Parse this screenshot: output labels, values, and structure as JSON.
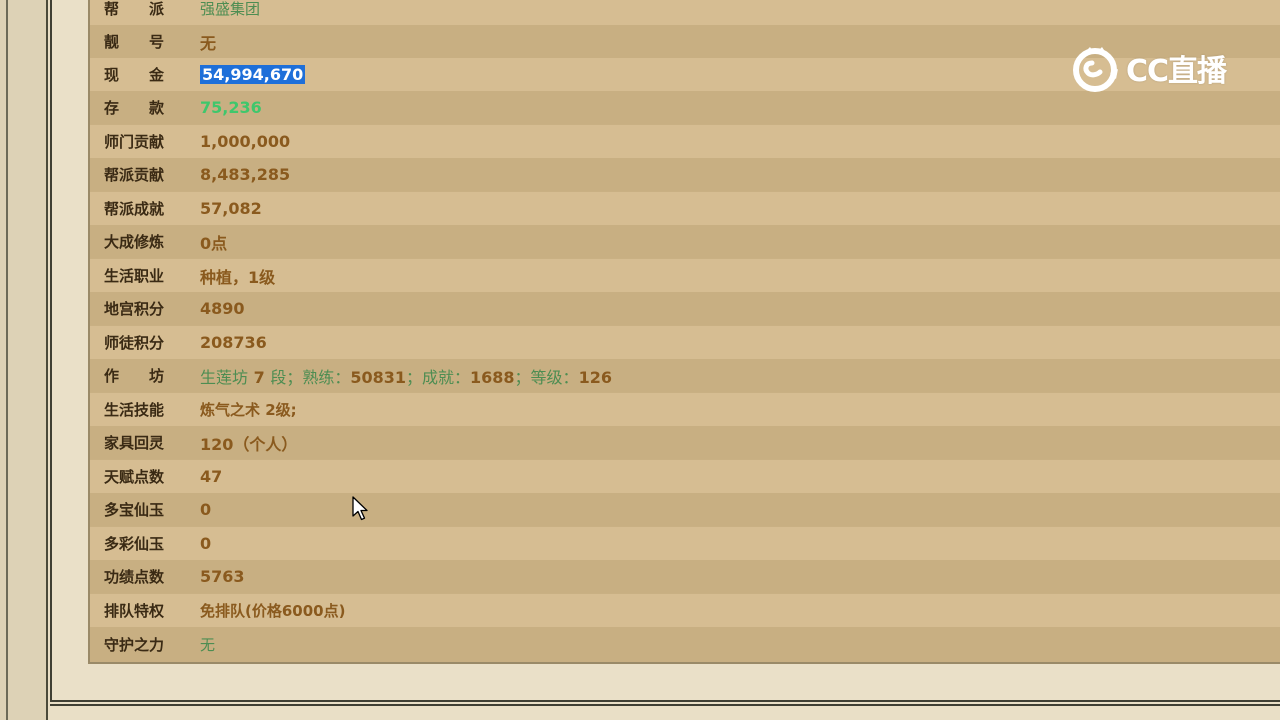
{
  "rows": [
    {
      "label": "帮　　派",
      "value": "强盛集团"
    },
    {
      "label": "靓　　号",
      "value": "无"
    },
    {
      "label": "现　　金",
      "value": "54,994,670"
    },
    {
      "label": "存　　款",
      "value": "75,236"
    },
    {
      "label": "师门贡献",
      "value": "1,000,000"
    },
    {
      "label": "帮派贡献",
      "value": "8,483,285"
    },
    {
      "label": "帮派成就",
      "value": "57,082"
    },
    {
      "label": "大成修炼",
      "value": "0点"
    },
    {
      "label": "生活职业",
      "value": "种植，1级"
    },
    {
      "label": "地宫积分",
      "value": "4890"
    },
    {
      "label": "师徒积分",
      "value": "208736"
    },
    {
      "label": "作　　坊",
      "value_parts": [
        "生莲坊",
        "7",
        "段；熟练：",
        "50831",
        "；成就：",
        "1688",
        "；等级：",
        "126"
      ]
    },
    {
      "label": "生活技能",
      "value": "炼气之术 2级;"
    },
    {
      "label": "家具回灵",
      "value": "120（个人）"
    },
    {
      "label": "天赋点数",
      "value": "47"
    },
    {
      "label": "多宝仙玉",
      "value": "0"
    },
    {
      "label": "多彩仙玉",
      "value": "0"
    },
    {
      "label": "功绩点数",
      "value": "5763"
    },
    {
      "label": "排队特权",
      "value": "免排队(价格6000点)"
    },
    {
      "label": "守护之力",
      "value": "无"
    }
  ],
  "watermark": {
    "text": "CC直播",
    "icon": "cc-live-logo-icon"
  },
  "cursor": {
    "icon": "mouse-pointer-icon"
  },
  "colors": {
    "value_brown": "#8a5a1e",
    "value_green": "#4d8d52",
    "deposit_green": "#3fc76c",
    "selection_blue": "#1e6fd9"
  }
}
